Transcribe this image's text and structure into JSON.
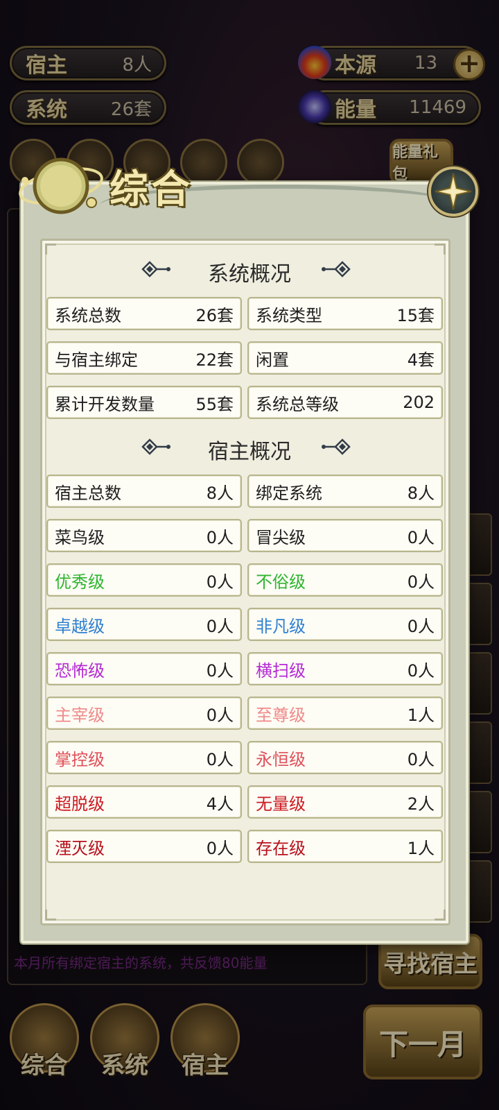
{
  "top_stats": {
    "host": {
      "label": "宿主",
      "value": "8人"
    },
    "system": {
      "label": "系统",
      "value": "26套"
    },
    "origin": {
      "label": "本源",
      "value": "13"
    },
    "energy": {
      "label": "能量",
      "value": "11469"
    }
  },
  "background": {
    "energy_gift": "能量礼包",
    "log_notice": "本月所有绑定宿主的系统，共反馈80能量",
    "find_host_button": "寻找宿主",
    "next_month_button": "下一月",
    "nav": [
      "综合",
      "系统",
      "宿主"
    ]
  },
  "dialog": {
    "title": "综合",
    "system_section": {
      "heading": "系统概况",
      "rows": [
        [
          {
            "label": "系统总数",
            "value": "26套"
          },
          {
            "label": "系统类型",
            "value": "15套"
          }
        ],
        [
          {
            "label": "与宿主绑定",
            "value": "22套"
          },
          {
            "label": "闲置",
            "value": "4套"
          }
        ],
        [
          {
            "label": "累计开发数量",
            "value": "55套"
          },
          {
            "label": "系统总等级",
            "value": "202"
          }
        ]
      ]
    },
    "host_section": {
      "heading": "宿主概况",
      "rows": [
        [
          {
            "label": "宿主总数",
            "value": "8人",
            "color": "#1e1e1e"
          },
          {
            "label": "绑定系统",
            "value": "8人",
            "color": "#1e1e1e"
          }
        ],
        [
          {
            "label": "菜鸟级",
            "value": "0人",
            "color": "#1e1e1e"
          },
          {
            "label": "冒尖级",
            "value": "0人",
            "color": "#1e1e1e"
          }
        ],
        [
          {
            "label": "优秀级",
            "value": "0人",
            "color": "#2fb52f"
          },
          {
            "label": "不俗级",
            "value": "0人",
            "color": "#2fb52f"
          }
        ],
        [
          {
            "label": "卓越级",
            "value": "0人",
            "color": "#2f7fd0"
          },
          {
            "label": "非凡级",
            "value": "0人",
            "color": "#2f7fd0"
          }
        ],
        [
          {
            "label": "恐怖级",
            "value": "0人",
            "color": "#b42ad4"
          },
          {
            "label": "横扫级",
            "value": "0人",
            "color": "#b42ad4"
          }
        ],
        [
          {
            "label": "主宰级",
            "value": "0人",
            "color": "#f08a8a"
          },
          {
            "label": "至尊级",
            "value": "1人",
            "color": "#f08a8a"
          }
        ],
        [
          {
            "label": "掌控级",
            "value": "0人",
            "color": "#e0505a"
          },
          {
            "label": "永恒级",
            "value": "0人",
            "color": "#e0505a"
          }
        ],
        [
          {
            "label": "超脱级",
            "value": "4人",
            "color": "#cc1a22"
          },
          {
            "label": "无量级",
            "value": "2人",
            "color": "#cc1a22"
          }
        ],
        [
          {
            "label": "湮灭级",
            "value": "0人",
            "color": "#b8101c"
          },
          {
            "label": "存在级",
            "value": "1人",
            "color": "#b8101c"
          }
        ]
      ]
    }
  }
}
